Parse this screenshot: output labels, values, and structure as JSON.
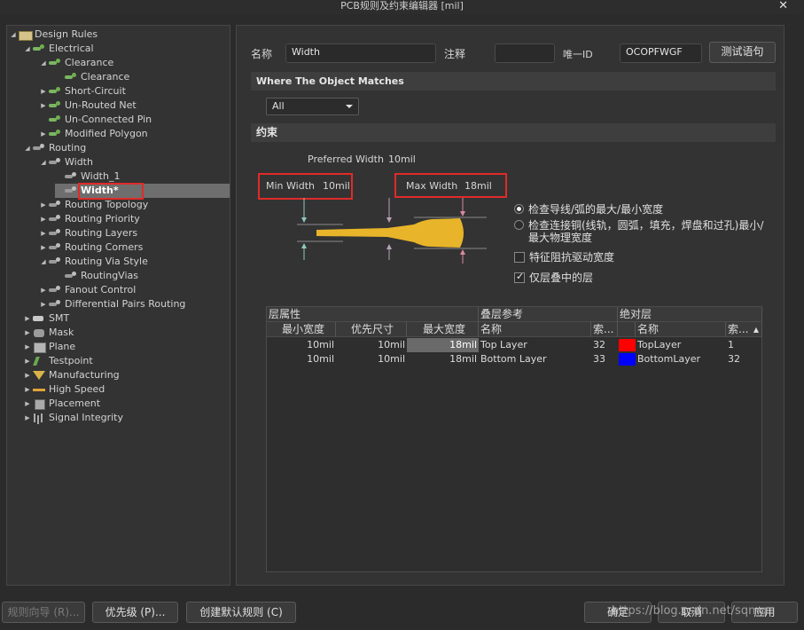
{
  "window": {
    "title": "PCB规则及约束编辑器 [mil]",
    "close_glyph": "✕"
  },
  "tree": [
    {
      "label": "Design Rules",
      "icon": "folder-icon",
      "arrow": "◢"
    },
    {
      "label": "Electrical",
      "icon": "green-rule-icon",
      "arrow": "◢"
    },
    {
      "label": "Clearance",
      "icon": "green-rule-icon",
      "arrow": "◢"
    },
    {
      "label": "Clearance",
      "icon": "green-rule-icon",
      "arrow": ""
    },
    {
      "label": "Short-Circuit",
      "icon": "green-rule-icon",
      "arrow": "▶"
    },
    {
      "label": "Un-Routed Net",
      "icon": "green-rule-icon",
      "arrow": "▶"
    },
    {
      "label": "Un-Connected Pin",
      "icon": "green-rule-icon",
      "arrow": ""
    },
    {
      "label": "Modified Polygon",
      "icon": "green-rule-icon",
      "arrow": "▶"
    },
    {
      "label": "Routing",
      "icon": "rule-icon",
      "arrow": "◢"
    },
    {
      "label": "Width",
      "icon": "rule-icon",
      "arrow": "◢"
    },
    {
      "label": "Width_1",
      "icon": "rule-icon",
      "arrow": ""
    },
    {
      "label": "Width*",
      "icon": "rule-icon",
      "arrow": ""
    },
    {
      "label": "Routing Topology",
      "icon": "rule-icon",
      "arrow": "▶"
    },
    {
      "label": "Routing Priority",
      "icon": "rule-icon",
      "arrow": "▶"
    },
    {
      "label": "Routing Layers",
      "icon": "rule-icon",
      "arrow": "▶"
    },
    {
      "label": "Routing Corners",
      "icon": "rule-icon",
      "arrow": "▶"
    },
    {
      "label": "Routing Via Style",
      "icon": "rule-icon",
      "arrow": "◢"
    },
    {
      "label": "RoutingVias",
      "icon": "rule-icon",
      "arrow": ""
    },
    {
      "label": "Fanout Control",
      "icon": "rule-icon",
      "arrow": "▶"
    },
    {
      "label": "Differential Pairs Routing",
      "icon": "rule-icon",
      "arrow": "▶"
    },
    {
      "label": "SMT",
      "icon": "smt-icon",
      "arrow": "▶"
    },
    {
      "label": "Mask",
      "icon": "mask-icon",
      "arrow": "▶"
    },
    {
      "label": "Plane",
      "icon": "plane-icon",
      "arrow": "▶"
    },
    {
      "label": "Testpoint",
      "icon": "testpoint-icon",
      "arrow": "▶"
    },
    {
      "label": "Manufacturing",
      "icon": "manufacturing-icon",
      "arrow": "▶"
    },
    {
      "label": "High Speed",
      "icon": "high-speed-icon",
      "arrow": "▶"
    },
    {
      "label": "Placement",
      "icon": "placement-icon",
      "arrow": "▶"
    },
    {
      "label": "Signal Integrity",
      "icon": "signal-integrity-icon",
      "arrow": "▶"
    }
  ],
  "header": {
    "name_label": "名称",
    "name_value": "Width",
    "comment_label": "注释",
    "comment_value": "",
    "uid_label": "唯一ID",
    "uid_value": "OCOPFWGF",
    "test_button": "测试语句"
  },
  "where": {
    "title": "Where The Object Matches",
    "scope_value": "All"
  },
  "constraints": {
    "title": "约束",
    "preferred_label": "Preferred Width",
    "preferred_value": "10mil",
    "min_label": "Min Width",
    "min_value": "10mil",
    "max_label": "Max Width",
    "max_value": "18mil",
    "trace_color": "#e8b429",
    "options": [
      {
        "label": "检查导线/弧的最大/最小宽度",
        "type": "radio",
        "checked": true
      },
      {
        "label": "检查连接铜(线轨，圆弧，填充，焊盘和过孔)最小/最大物理宽度",
        "type": "radio",
        "checked": false
      },
      {
        "label": "特征阻抗驱动宽度",
        "type": "checkbox",
        "checked": false
      },
      {
        "label": "仅层叠中的层",
        "type": "checkbox",
        "checked": true
      }
    ]
  },
  "grid": {
    "group_headers": [
      "层属性",
      "叠层参考",
      "绝对层"
    ],
    "columns": [
      "最小宽度",
      "优先尺寸",
      "最大宽度",
      "名称",
      "索...",
      "名称",
      "索..."
    ],
    "rows": [
      {
        "min": "10mil",
        "pref": "10mil",
        "max": "18mil",
        "stack_name": "Top Layer",
        "stack_idx": "32",
        "color": "#ff0000",
        "abs_name": "TopLayer",
        "abs_idx": "1"
      },
      {
        "min": "10mil",
        "pref": "10mil",
        "max": "18mil",
        "stack_name": "Bottom Layer",
        "stack_idx": "33",
        "color": "#0000ff",
        "abs_name": "BottomLayer",
        "abs_idx": "32"
      }
    ]
  },
  "footer": {
    "wizard": "规则向导 (R)...",
    "priority": "优先级 (P)...",
    "create_default": "创建默认规则 (C)",
    "ok": "确定",
    "cancel": "取消",
    "apply": "应用",
    "watermark": "https://blog.csdn.net/sqmq"
  }
}
